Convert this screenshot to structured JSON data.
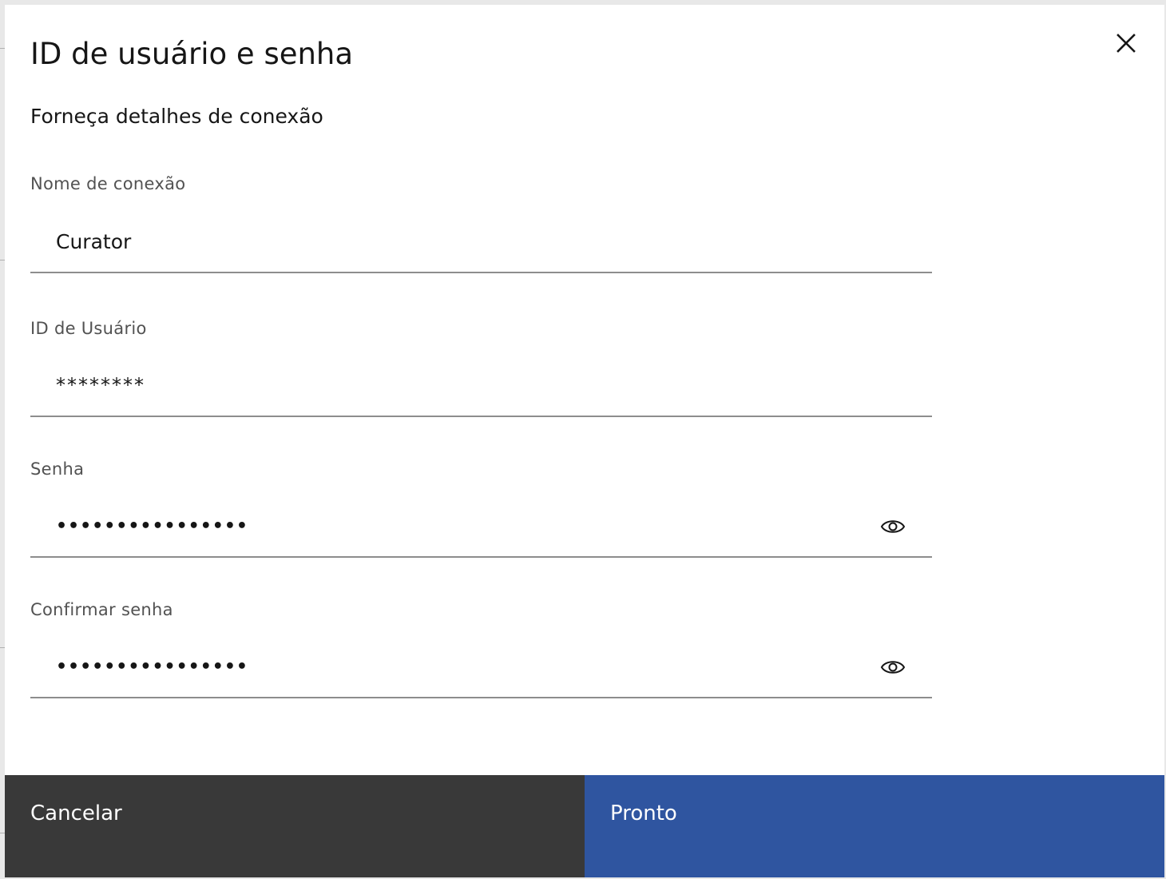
{
  "modal": {
    "title": "ID de usuário e senha",
    "subtitle": "Forneça detalhes de conexão",
    "close_icon": "close-icon"
  },
  "fields": {
    "connection_name": {
      "label": "Nome de conexão",
      "value": "Curator"
    },
    "user_id": {
      "label": "ID de Usuário",
      "value": "********"
    },
    "password": {
      "label": "Senha",
      "value": "••••••••••••••••",
      "toggle_icon": "eye-icon"
    },
    "confirm_password": {
      "label": "Confirmar senha",
      "value": "••••••••••••••••",
      "toggle_icon": "eye-icon"
    }
  },
  "footer": {
    "cancel_label": "Cancelar",
    "primary_label": "Pronto"
  },
  "colors": {
    "primary": "#2f55a0",
    "secondary": "#393939",
    "text": "#161616",
    "label": "#525252"
  }
}
